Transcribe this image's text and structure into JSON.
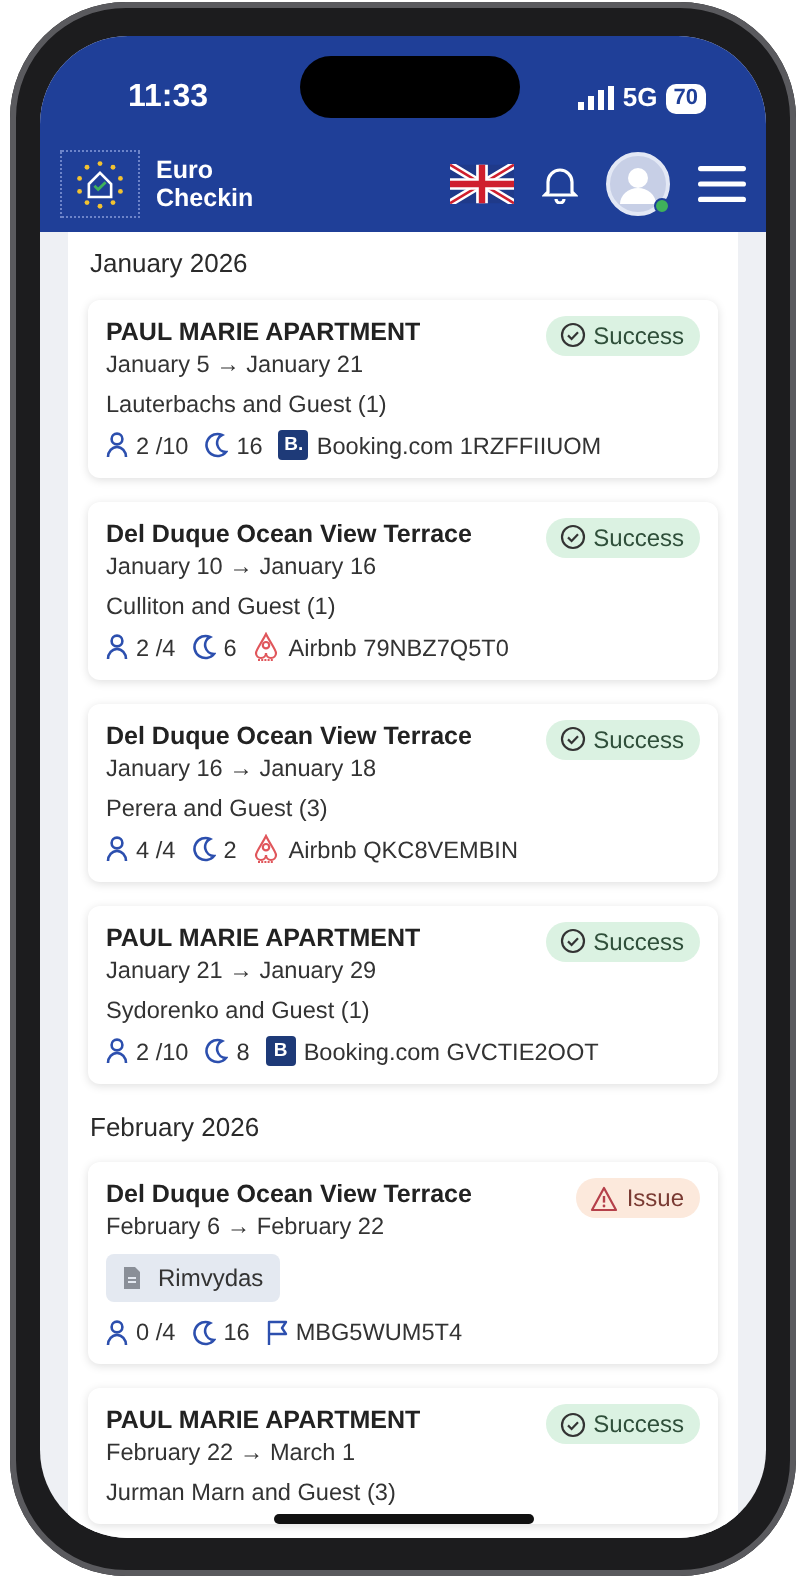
{
  "status_bar": {
    "time": "11:33",
    "network": "5G",
    "battery": "70"
  },
  "header": {
    "app_name": "Euro Checkin",
    "profile_online": true
  },
  "groups": [
    {
      "month": "January 2026",
      "bookings": [
        {
          "property": "PAUL MARIE APARTMENT",
          "dates": "January 5 → January 21",
          "guests": "Lauterbachs and Guest (1)",
          "status": {
            "kind": "success",
            "label": "Success"
          },
          "occupancy": "2 /10",
          "nights": "16",
          "source": {
            "kind": "booking",
            "badge": "B.",
            "label": "Booking.com 1RZFFIIUOM"
          }
        },
        {
          "property": "Del Duque Ocean View Terrace",
          "dates": "January 10 → January 16",
          "guests": "Culliton and Guest (1)",
          "status": {
            "kind": "success",
            "label": "Success"
          },
          "occupancy": "2 /4",
          "nights": "6",
          "source": {
            "kind": "airbnb",
            "label": "Airbnb 79NBZ7Q5T0"
          }
        },
        {
          "property": "Del Duque Ocean View Terrace",
          "dates": "January 16 → January 18",
          "guests": "Perera and Guest (3)",
          "status": {
            "kind": "success",
            "label": "Success"
          },
          "occupancy": "4 /4",
          "nights": "2",
          "source": {
            "kind": "airbnb",
            "label": "Airbnb QKC8VEMBIN"
          }
        },
        {
          "property": "PAUL MARIE APARTMENT",
          "dates": "January 21 → January 29",
          "guests": "Sydorenko and Guest (1)",
          "status": {
            "kind": "success",
            "label": "Success"
          },
          "occupancy": "2 /10",
          "nights": "8",
          "source": {
            "kind": "booking",
            "badge": "B",
            "label": "Booking.com GVCTIE2OOT"
          }
        }
      ]
    },
    {
      "month": "February 2026",
      "bookings": [
        {
          "property": "Del Duque Ocean View Terrace",
          "dates": "February 6 → February 22",
          "document_tag": "Rimvydas",
          "status": {
            "kind": "issue",
            "label": "Issue"
          },
          "occupancy": "0 /4",
          "nights": "16",
          "source": {
            "kind": "direct",
            "label": "MBG5WUM5T4"
          }
        },
        {
          "property": "PAUL MARIE APARTMENT",
          "dates": "February 22 → March 1",
          "guests": "Jurman Marn and Guest (3)",
          "status": {
            "kind": "success",
            "label": "Success"
          }
        }
      ]
    }
  ]
}
